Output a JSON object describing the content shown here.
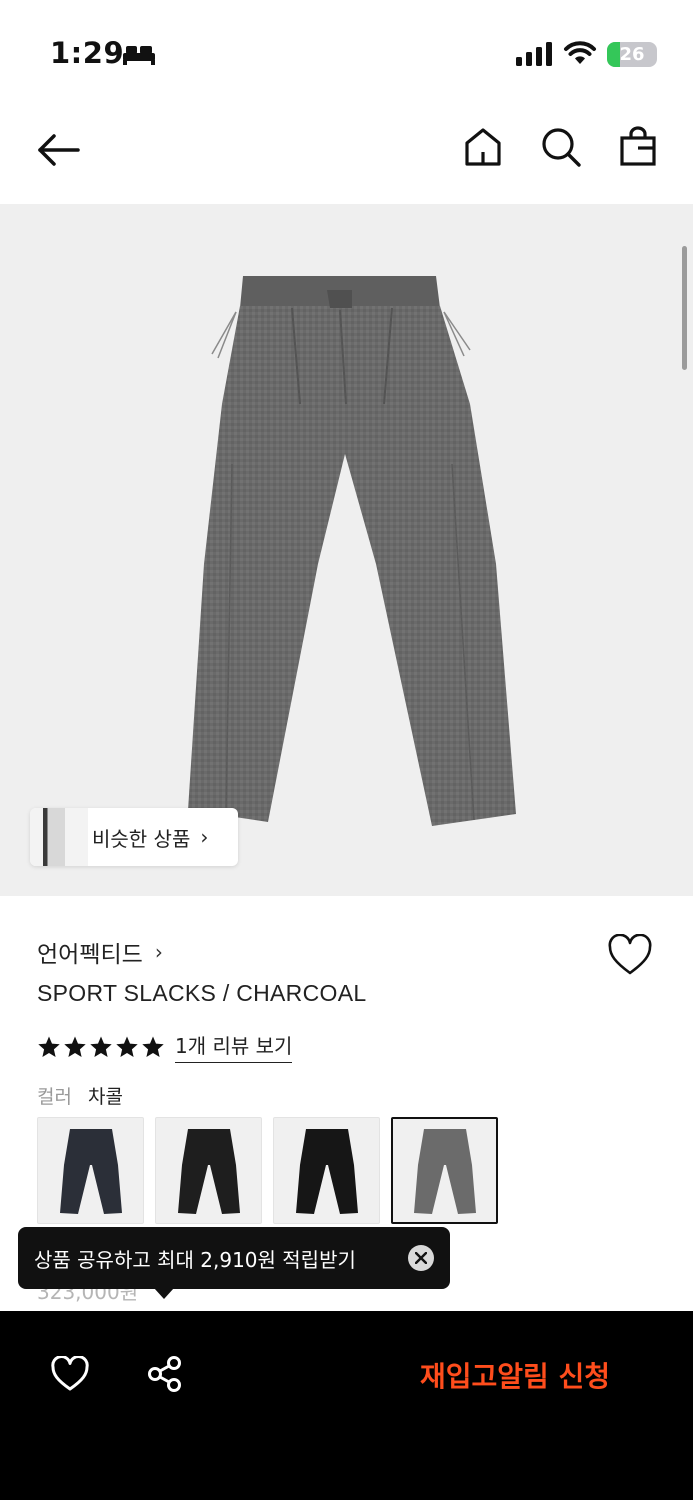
{
  "status_bar": {
    "time": "1:29",
    "battery_level": "26",
    "battery_fraction": 0.26
  },
  "nav": {
    "icons": [
      "back-arrow-icon",
      "home-icon",
      "search-icon",
      "shopping-bag-icon"
    ]
  },
  "hero": {
    "similar_label": "비슷한 상품",
    "similar_chevron": "›",
    "background": "#efefef"
  },
  "product": {
    "brand": "언어펙티드",
    "brand_chevron": "›",
    "title": "SPORT SLACKS / CHARCOAL",
    "rating_stars": 5,
    "review_link": "1개 리뷰 보기",
    "color_label": "컬러",
    "color_value": "차콜",
    "swatches": [
      {
        "name": "navy",
        "color": "#2b2f38"
      },
      {
        "name": "black-1",
        "color": "#1e1e1e"
      },
      {
        "name": "black-2",
        "color": "#161616"
      },
      {
        "name": "charcoal",
        "color": "#6b6b6b",
        "selected": true
      }
    ],
    "price_partial": "323,000원"
  },
  "tooltip": {
    "text": "상품 공유하고 최대 2,910원 적립받기"
  },
  "bottom_bar": {
    "restock_label": "재입고알림 신청",
    "accent_color": "#ff4d1c"
  }
}
